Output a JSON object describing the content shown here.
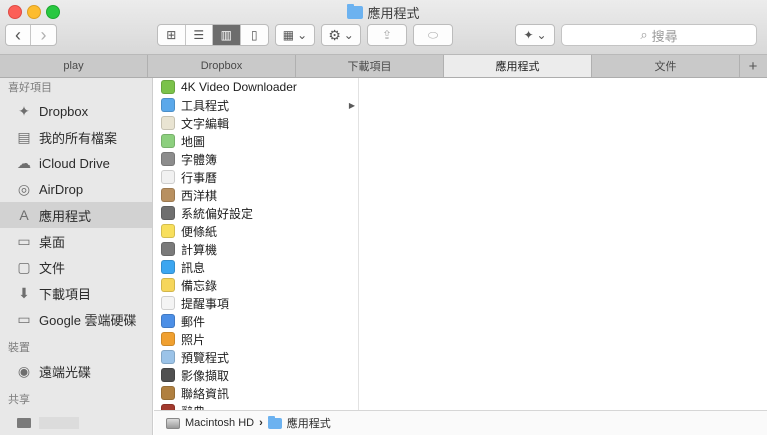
{
  "window": {
    "title": "應用程式"
  },
  "toolbar": {
    "back_glyph": "‹",
    "forward_glyph": "›",
    "view_icon_glyph": "⊞",
    "view_list_glyph": "☰",
    "view_column_glyph": "▥",
    "view_cover_glyph": "▯",
    "arrange_glyph": "▦",
    "action_glyph": "⚙",
    "share_glyph": "⇪",
    "tag_glyph": "⬭",
    "dropbox_glyph": "✦",
    "dropdown_glyph": "⌄",
    "search_glyph": "⌕",
    "search_placeholder": "搜尋"
  },
  "tabs": [
    {
      "label": "play"
    },
    {
      "label": "Dropbox"
    },
    {
      "label": "下載項目"
    },
    {
      "label": "應用程式"
    },
    {
      "label": "文件"
    }
  ],
  "tab_add_glyph": "+",
  "sidebar": {
    "favorites_header": "喜好項目",
    "favorites": [
      {
        "label": "Dropbox",
        "glyph": "✦"
      },
      {
        "label": "我的所有檔案",
        "glyph": "▤"
      },
      {
        "label": "iCloud Drive",
        "glyph": "☁"
      },
      {
        "label": "AirDrop",
        "glyph": "◎"
      },
      {
        "label": "應用程式",
        "glyph": "A"
      },
      {
        "label": "桌面",
        "glyph": "▭"
      },
      {
        "label": "文件",
        "glyph": "▢"
      },
      {
        "label": "下載項目",
        "glyph": "⬇"
      },
      {
        "label": "Google 雲端硬碟",
        "glyph": "▭"
      }
    ],
    "devices_header": "裝置",
    "devices": [
      {
        "label": "遠端光碟",
        "glyph": "◉"
      }
    ],
    "shared_header": "共享"
  },
  "apps": [
    {
      "name": "4K Video Downloader",
      "color": "#7bc24a",
      "has_children": false
    },
    {
      "name": "工具程式",
      "color": "#5aa8ea",
      "has_children": true
    },
    {
      "name": "文字編輯",
      "color": "#e9e4d2",
      "has_children": false
    },
    {
      "name": "地圖",
      "color": "#8ccf7e",
      "has_children": false
    },
    {
      "name": "字體簿",
      "color": "#8c8c8c",
      "has_children": false
    },
    {
      "name": "行事曆",
      "color": "#f1f1f1",
      "has_children": false
    },
    {
      "name": "西洋棋",
      "color": "#b89060",
      "has_children": false
    },
    {
      "name": "系統偏好設定",
      "color": "#6f6f6f",
      "has_children": false
    },
    {
      "name": "便條紙",
      "color": "#f8df5c",
      "has_children": false
    },
    {
      "name": "計算機",
      "color": "#7a7a7a",
      "has_children": false
    },
    {
      "name": "訊息",
      "color": "#3ca6f0",
      "has_children": false
    },
    {
      "name": "備忘錄",
      "color": "#f6d65a",
      "has_children": false
    },
    {
      "name": "提醒事項",
      "color": "#f4f4f4",
      "has_children": false
    },
    {
      "name": "郵件",
      "color": "#4c8fe6",
      "has_children": false
    },
    {
      "name": "照片",
      "color": "#f0a030",
      "has_children": false
    },
    {
      "name": "預覽程式",
      "color": "#9bc3e8",
      "has_children": false
    },
    {
      "name": "影像擷取",
      "color": "#505050",
      "has_children": false
    },
    {
      "name": "聯絡資訊",
      "color": "#b08040",
      "has_children": false
    },
    {
      "name": "辭典",
      "color": "#a33a2e",
      "has_children": false
    }
  ],
  "has_children_glyph": "▶",
  "pathbar": {
    "disk": "Macintosh HD",
    "separator": "›",
    "folder": "應用程式"
  }
}
